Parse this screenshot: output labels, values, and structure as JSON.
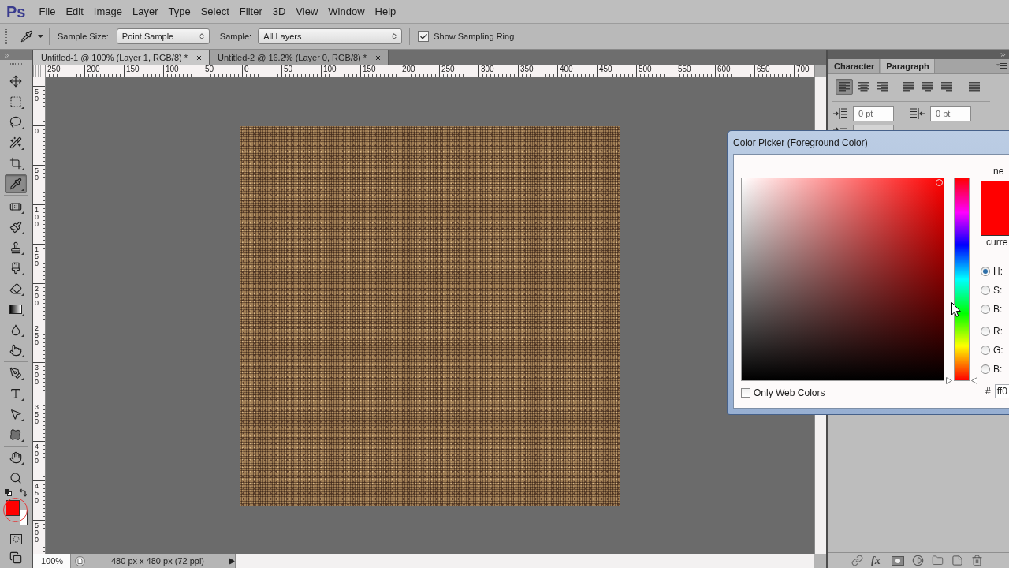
{
  "menu_bar": {
    "logo": "Ps",
    "items": [
      "File",
      "Edit",
      "Image",
      "Layer",
      "Type",
      "Select",
      "Filter",
      "3D",
      "View",
      "Window",
      "Help"
    ]
  },
  "options_bar": {
    "sample_size_label": "Sample Size:",
    "sample_size": "Point Sample",
    "sample_label": "Sample:",
    "sample": "All Layers",
    "sampling_ring": {
      "label": "Show Sampling Ring",
      "checked": true
    }
  },
  "toolbar": {
    "tools": [
      {
        "kind": "move",
        "selected": false,
        "flyout": false
      },
      {
        "kind": "marquee",
        "selected": false,
        "flyout": true
      },
      {
        "kind": "lasso",
        "selected": false,
        "flyout": true
      },
      {
        "kind": "wand",
        "selected": false,
        "flyout": true
      },
      {
        "kind": "crop",
        "selected": false,
        "flyout": true
      },
      {
        "kind": "eyedropper",
        "selected": true,
        "flyout": true
      },
      {
        "kind": "healing",
        "selected": false,
        "flyout": true
      },
      {
        "kind": "brush",
        "selected": false,
        "flyout": true
      },
      {
        "kind": "stamp",
        "selected": false,
        "flyout": true
      },
      {
        "kind": "history",
        "selected": false,
        "flyout": true
      },
      {
        "kind": "eraser",
        "selected": false,
        "flyout": true
      },
      {
        "kind": "gradient",
        "selected": false,
        "flyout": true
      },
      {
        "kind": "blur",
        "selected": false,
        "flyout": true
      },
      {
        "kind": "smudge",
        "selected": false,
        "flyout": true
      },
      {
        "kind": "pen",
        "selected": false,
        "flyout": true
      },
      {
        "kind": "type",
        "selected": false,
        "flyout": true
      },
      {
        "kind": "path",
        "selected": false,
        "flyout": true
      },
      {
        "kind": "shape",
        "selected": false,
        "flyout": true
      },
      {
        "kind": "hand",
        "selected": false,
        "flyout": true
      },
      {
        "kind": "zoom",
        "selected": false,
        "flyout": false
      }
    ],
    "foreground": {
      "color": "#ff0000"
    },
    "background": {
      "color": "#ffffff"
    }
  },
  "document_tabs": [
    {
      "label": "Untitled-1 @ 100% (Layer 1, RGB/8) *",
      "selected": true
    },
    {
      "label": "Untitled-2 @ 16.2% (Layer 0, RGB/8) *",
      "selected": false
    }
  ],
  "rulers": {
    "horizontal": [
      "250",
      "200",
      "150",
      "100",
      "50",
      "0",
      "50",
      "100",
      "150",
      "200",
      "250",
      "300",
      "350",
      "400",
      "450",
      "500",
      "550",
      "600",
      "650",
      "700"
    ],
    "vertical": [
      "50",
      "0",
      "50",
      "100",
      "150",
      "200",
      "250",
      "300",
      "350",
      "400",
      "450",
      "500"
    ]
  },
  "status_bar": {
    "zoom": "100%",
    "document_info": "480 px x 480 px (72 ppi)"
  },
  "paragraph_panel": {
    "tabs": [
      {
        "label": "Character",
        "selected": false
      },
      {
        "label": "Paragraph",
        "selected": true
      }
    ],
    "alignment": [
      {
        "kind": "left",
        "selected": true
      },
      {
        "kind": "center",
        "selected": false
      },
      {
        "kind": "right",
        "selected": false
      },
      {
        "kind": "justify-left",
        "selected": false
      },
      {
        "kind": "justify-center",
        "selected": false
      },
      {
        "kind": "justify-right",
        "selected": false
      },
      {
        "kind": "justify-all",
        "selected": false
      }
    ],
    "indents": [
      {
        "kind": "left",
        "value": "0 pt"
      },
      {
        "kind": "right",
        "value": "0 pt"
      }
    ]
  },
  "layers_footer": {
    "effects": "fx"
  },
  "color_picker": {
    "title": "Color Picker (Foreground Color)",
    "new": {
      "label": "ne",
      "color": "#ff0000"
    },
    "current": {
      "label": "curre",
      "color": "#ff0000"
    },
    "hue_slider": {
      "level": 0
    },
    "modes": [
      {
        "label": "H:",
        "selected": true
      },
      {
        "label": "S:",
        "selected": false
      },
      {
        "label": "B:",
        "selected": false
      },
      {
        "label": "R:",
        "selected": false
      },
      {
        "label": "G:",
        "selected": false
      },
      {
        "label": "B:",
        "selected": false
      }
    ],
    "only_web_colors": {
      "label": "Only Web Colors",
      "checked": false
    },
    "hex_label": "#",
    "hex_value": "ff0"
  }
}
